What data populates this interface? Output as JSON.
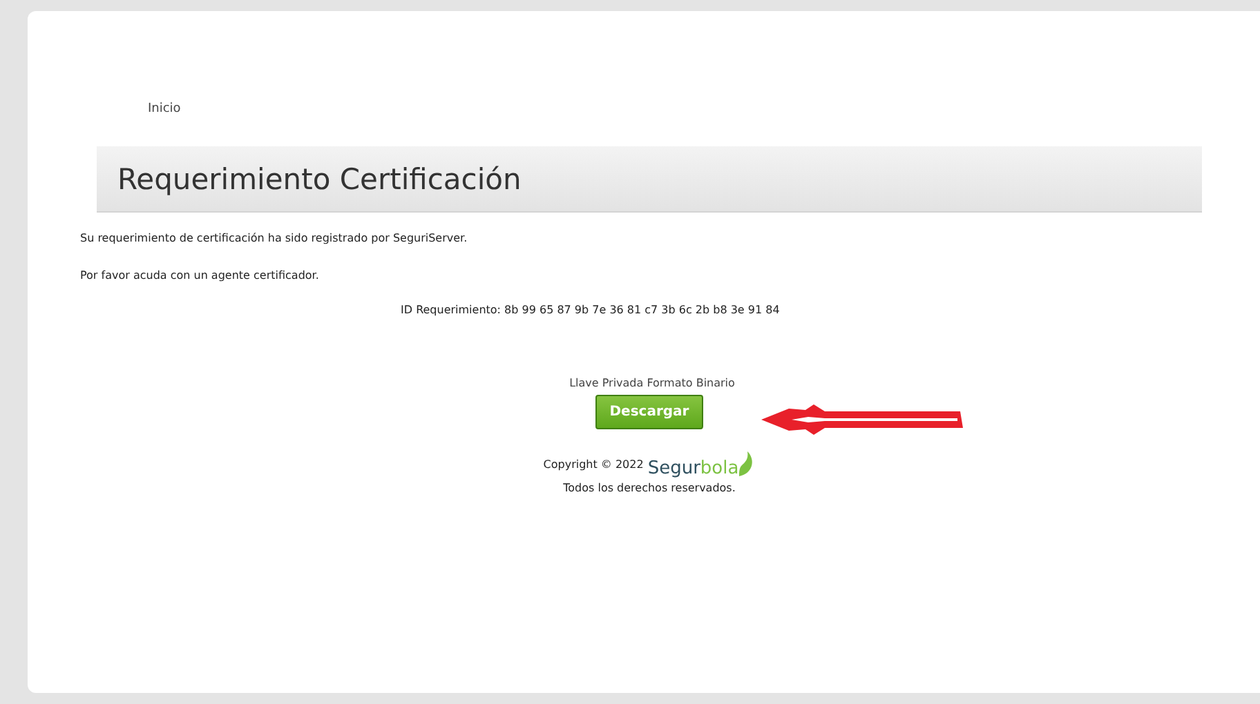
{
  "breadcrumb": "Inicio",
  "panel": {
    "title": "Requerimiento Certificación"
  },
  "messages": [
    "Su requerimiento de certificación ha sido registrado por SeguriServer.",
    "Por favor acuda con un agente certificador."
  ],
  "request_id": "ID Requerimiento: 8b 99 65 87 9b 7e 36 81 c7 3b 6c 2b b8 3e 91 84",
  "download": {
    "label": "Llave Privada Formato Binario",
    "button": "Descargar"
  },
  "footer": {
    "copyright": "Copyright © 2022",
    "logo": {
      "part_1": "Segur",
      "part_2": "bola"
    },
    "rights": "Todos los derechos reservados."
  }
}
